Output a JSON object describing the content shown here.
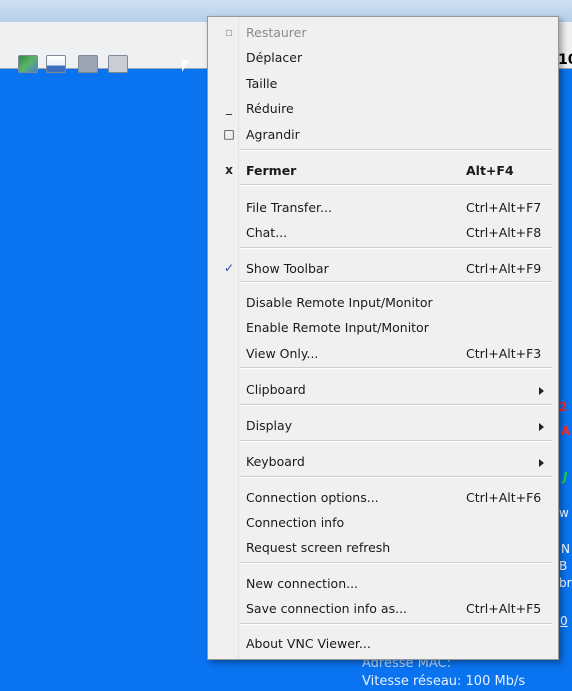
{
  "background": {
    "bottom_status": [
      "Adresse MAC:",
      "Vitesse réseau:  100 Mb/s"
    ],
    "toolbar_right_text": "10",
    "fragments": [
      "2",
      "A",
      "J",
      "w",
      "N",
      "B",
      "br",
      "0"
    ]
  },
  "menu": {
    "items": [
      {
        "id": "restaurer",
        "label": "Restaurer",
        "shortcut": "",
        "icon": "restore-icon",
        "icon_glyph": "▫",
        "disabled": true,
        "bold": false,
        "submenu": false
      },
      {
        "id": "deplacer",
        "label": "Déplacer",
        "shortcut": "",
        "icon": "",
        "icon_glyph": "",
        "disabled": false,
        "bold": false,
        "submenu": false
      },
      {
        "id": "taille",
        "label": "Taille",
        "shortcut": "",
        "icon": "",
        "icon_glyph": "",
        "disabled": false,
        "bold": false,
        "submenu": false
      },
      {
        "id": "reduire",
        "label": "Réduire",
        "shortcut": "",
        "icon": "minimize-icon",
        "icon_glyph": "_",
        "disabled": false,
        "bold": false,
        "submenu": false
      },
      {
        "id": "agrandir",
        "label": "Agrandir",
        "shortcut": "",
        "icon": "maximize-icon",
        "icon_glyph": "□",
        "disabled": false,
        "bold": false,
        "submenu": false
      },
      {
        "id": "fermer",
        "label": "Fermer",
        "shortcut": "Alt+F4",
        "icon": "close-icon",
        "icon_glyph": "x",
        "disabled": false,
        "bold": true,
        "submenu": false
      },
      {
        "id": "file-transfer",
        "label": "File Transfer...",
        "shortcut": "Ctrl+Alt+F7",
        "icon": "",
        "icon_glyph": "",
        "disabled": false,
        "bold": false,
        "submenu": false
      },
      {
        "id": "chat",
        "label": "Chat...",
        "shortcut": "Ctrl+Alt+F8",
        "icon": "",
        "icon_glyph": "",
        "disabled": false,
        "bold": false,
        "submenu": false
      },
      {
        "id": "show-toolbar",
        "label": "Show Toolbar",
        "shortcut": "Ctrl+Alt+F9",
        "icon": "checkmark-icon",
        "icon_glyph": "✓",
        "disabled": false,
        "bold": false,
        "submenu": false
      },
      {
        "id": "disable-remote",
        "label": "Disable Remote Input/Monitor",
        "shortcut": "",
        "icon": "",
        "icon_glyph": "",
        "disabled": false,
        "bold": false,
        "submenu": false
      },
      {
        "id": "enable-remote",
        "label": "Enable Remote Input/Monitor",
        "shortcut": "",
        "icon": "",
        "icon_glyph": "",
        "disabled": false,
        "bold": false,
        "submenu": false
      },
      {
        "id": "view-only",
        "label": "View Only...",
        "shortcut": "Ctrl+Alt+F3",
        "icon": "",
        "icon_glyph": "",
        "disabled": false,
        "bold": false,
        "submenu": false
      },
      {
        "id": "clipboard",
        "label": "Clipboard",
        "shortcut": "",
        "icon": "",
        "icon_glyph": "",
        "disabled": false,
        "bold": false,
        "submenu": true
      },
      {
        "id": "display",
        "label": "Display",
        "shortcut": "",
        "icon": "",
        "icon_glyph": "",
        "disabled": false,
        "bold": false,
        "submenu": true
      },
      {
        "id": "keyboard",
        "label": "Keyboard",
        "shortcut": "",
        "icon": "",
        "icon_glyph": "",
        "disabled": false,
        "bold": false,
        "submenu": true
      },
      {
        "id": "connection-options",
        "label": "Connection options...",
        "shortcut": "Ctrl+Alt+F6",
        "icon": "",
        "icon_glyph": "",
        "disabled": false,
        "bold": false,
        "submenu": false
      },
      {
        "id": "connection-info",
        "label": "Connection info",
        "shortcut": "",
        "icon": "",
        "icon_glyph": "",
        "disabled": false,
        "bold": false,
        "submenu": false
      },
      {
        "id": "request-refresh",
        "label": "Request screen refresh",
        "shortcut": "",
        "icon": "",
        "icon_glyph": "",
        "disabled": false,
        "bold": false,
        "submenu": false
      },
      {
        "id": "new-connection",
        "label": "New connection...",
        "shortcut": "",
        "icon": "",
        "icon_glyph": "",
        "disabled": false,
        "bold": false,
        "submenu": false
      },
      {
        "id": "save-connection",
        "label": "Save connection info as...",
        "shortcut": "Ctrl+Alt+F5",
        "icon": "",
        "icon_glyph": "",
        "disabled": false,
        "bold": false,
        "submenu": false
      },
      {
        "id": "about",
        "label": "About VNC Viewer...",
        "shortcut": "",
        "icon": "",
        "icon_glyph": "",
        "disabled": false,
        "bold": false,
        "submenu": false
      }
    ]
  }
}
